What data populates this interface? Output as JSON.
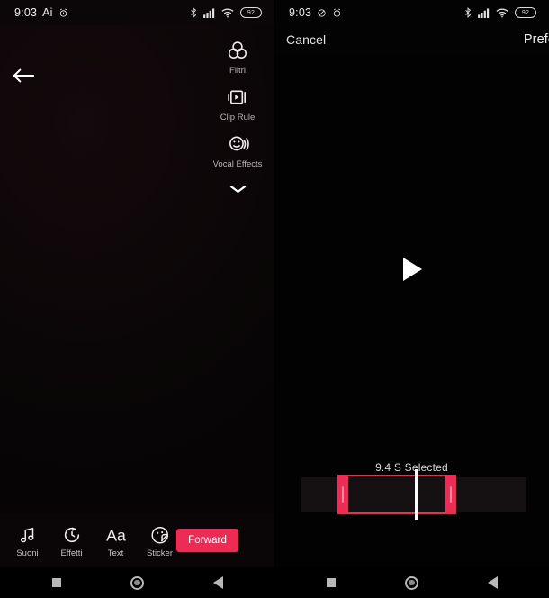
{
  "left": {
    "status_bar": {
      "time": "9:03",
      "am_pm": "Ai",
      "icons": [
        "alarm-icon",
        "bluetooth-icon",
        "signal-icon",
        "wifi-icon",
        "battery-icon"
      ],
      "battery_level": "92"
    },
    "back_button": "back-arrow-icon",
    "tool_rail": {
      "items": [
        {
          "icon": "filters-icon",
          "label": "Filtri"
        },
        {
          "icon": "clip-ruler-icon",
          "label": "Clip Rule"
        },
        {
          "icon": "vocal-effects-icon",
          "label": "Vocal Effects"
        }
      ],
      "collapse_icon": "chevron-down-icon"
    },
    "toolbar": {
      "items": [
        {
          "icon": "music-note-icon",
          "label": "Suoni"
        },
        {
          "icon": "effects-timer-icon",
          "label": "Effetti"
        },
        {
          "icon": "text-aa-icon",
          "label": "Text"
        },
        {
          "icon": "sticker-smiley-icon",
          "label": "Sticker"
        }
      ],
      "forward_label": "Forward",
      "forward_color": "#ED2B55"
    },
    "nav_bar": {
      "recents": "square-icon",
      "home": "circle-icon",
      "back": "triangle-back-icon"
    }
  },
  "right": {
    "status_bar": {
      "time": "9:03",
      "am_pm": "",
      "icons": [
        "mute-icon",
        "alarm-icon",
        "bluetooth-icon",
        "signal-icon",
        "wifi-icon",
        "battery-icon"
      ],
      "battery_level": "92"
    },
    "header": {
      "cancel_label": "Cancel",
      "confirm_label": "Prefer"
    },
    "preview": {
      "play_icon": "play-triangle-icon"
    },
    "selection_label": "9.4 S Selected",
    "trim": {
      "left_handle": "trim-handle-left",
      "right_handle": "trim-handle-right",
      "playhead": "playhead-marker",
      "accent_color": "#ED2B55"
    },
    "nav_bar": {
      "recents": "square-icon",
      "home": "circle-icon",
      "back": "triangle-back-icon"
    }
  }
}
